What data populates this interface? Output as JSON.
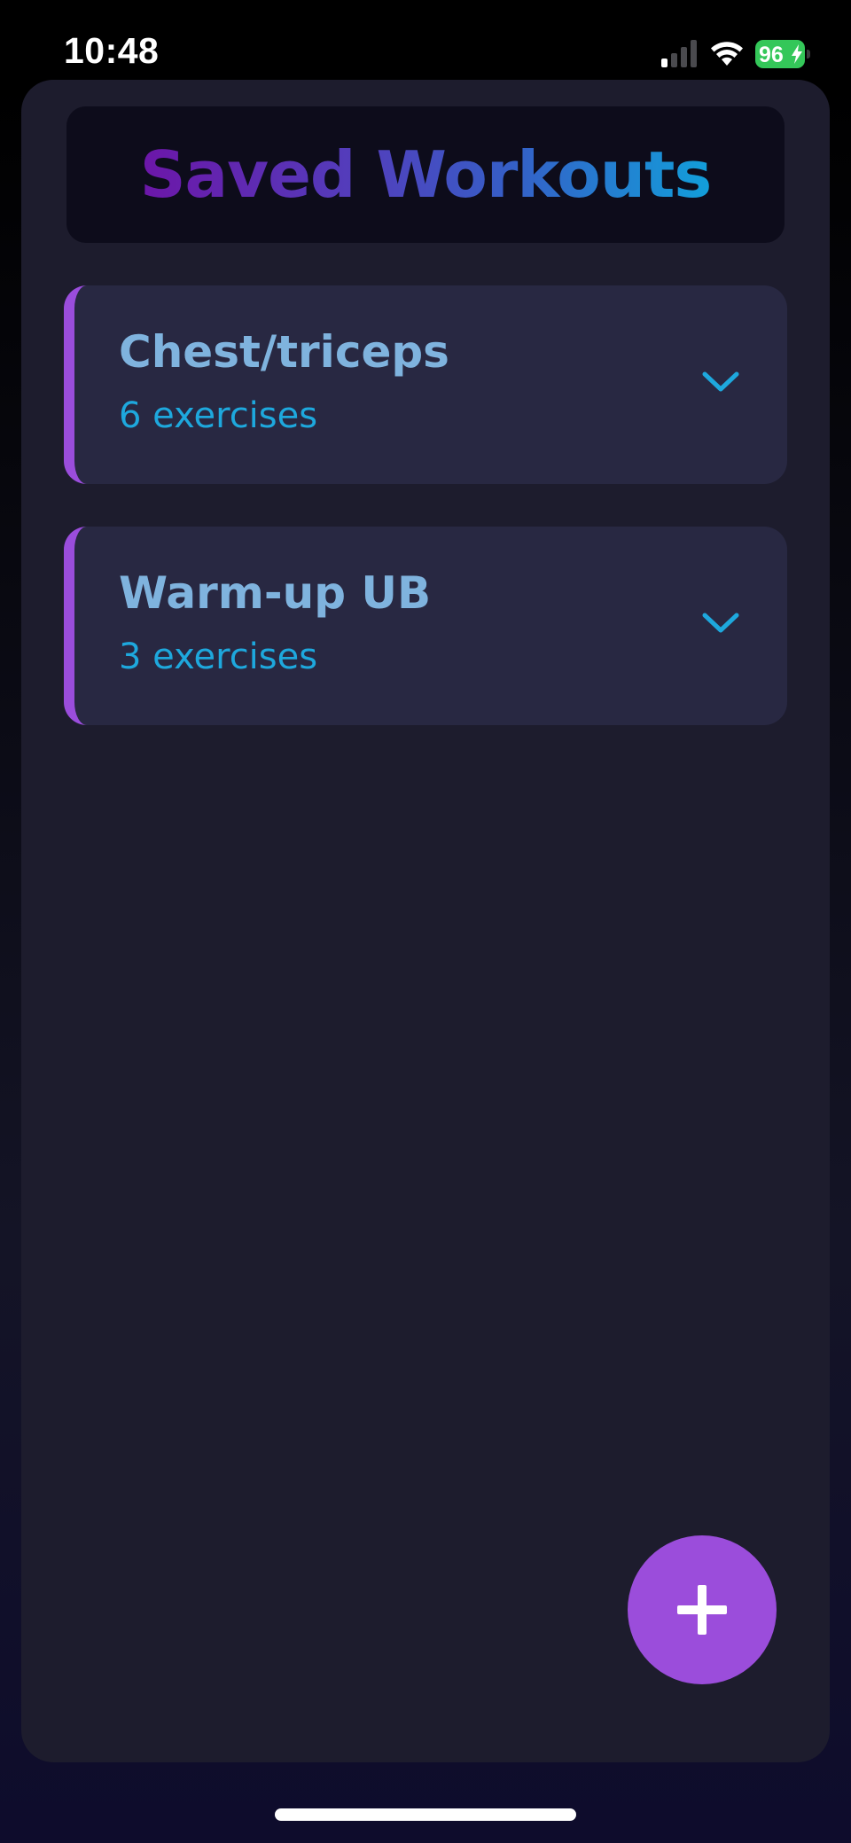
{
  "status_bar": {
    "time": "10:48",
    "battery_level": "96",
    "signal_bars_active": 1,
    "signal_bars_total": 4
  },
  "header": {
    "title": "Saved Workouts"
  },
  "workouts": [
    {
      "name": "Chest/triceps",
      "count_label": "6 exercises",
      "expand_icon": "chevron-down-icon"
    },
    {
      "name": "Warm-up UB",
      "count_label": "3 exercises",
      "expand_icon": "chevron-down-icon"
    }
  ],
  "fab": {
    "icon": "plus-icon"
  },
  "colors": {
    "accent": "#9b4ddb",
    "card_background": "#282842",
    "panel_background": "#1d1c2d",
    "workout_name": "#7fb3de",
    "exercise_count": "#1ea8dd",
    "battery": "#34c759",
    "title_gradient": [
      "#6c16a8",
      "#5140bd",
      "#355fc7",
      "#129fda"
    ]
  }
}
